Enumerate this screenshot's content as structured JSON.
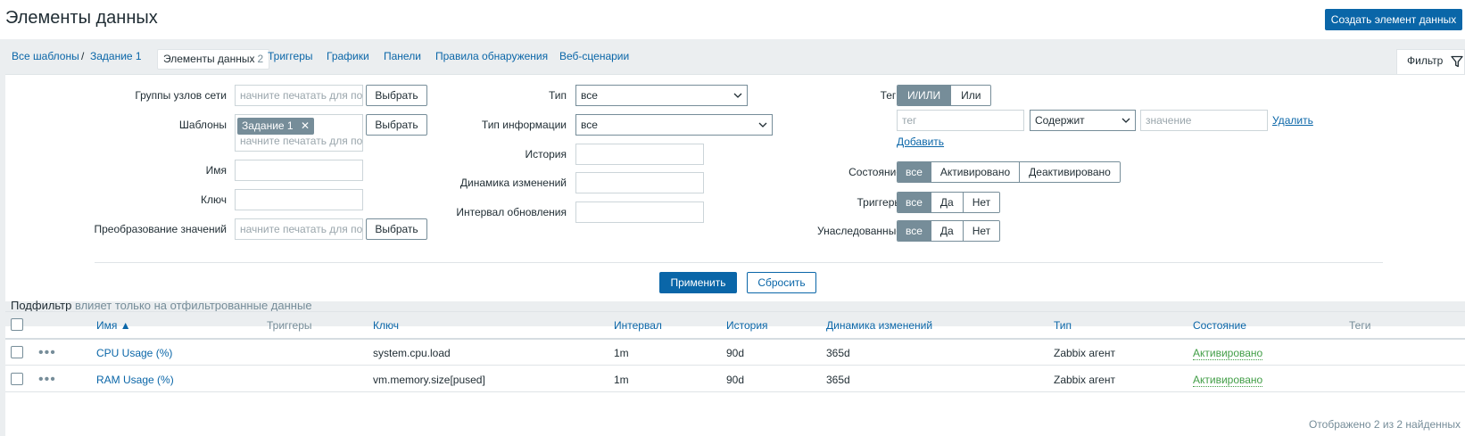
{
  "header": {
    "title": "Элементы данных",
    "create_button": "Создать элемент данных"
  },
  "nav": {
    "all_templates": "Все шаблоны",
    "separator": "/",
    "template": "Задание 1",
    "current": "Элементы данных",
    "current_count": "2",
    "triggers": "Триггеры",
    "graphs": "Графики",
    "dashboards": "Панели",
    "discovery": "Правила обнаружения",
    "web": "Веб-сценарии"
  },
  "filter_tab": {
    "label": "Фильтр",
    "icon": "filter-icon"
  },
  "filter": {
    "host_groups": {
      "label": "Группы узлов сети",
      "placeholder": "начните печатать для по",
      "button": "Выбрать"
    },
    "templates": {
      "label": "Шаблоны",
      "chip": "Задание 1",
      "placeholder": "начните печатать для по",
      "button": "Выбрать"
    },
    "name": {
      "label": "Имя",
      "value": ""
    },
    "key": {
      "label": "Ключ",
      "value": ""
    },
    "valuemap": {
      "label": "Преобразование значений",
      "placeholder": "начните печатать для по",
      "button": "Выбрать"
    },
    "type": {
      "label": "Тип",
      "value": "все"
    },
    "info_type": {
      "label": "Тип информации",
      "value": "все"
    },
    "history": {
      "label": "История",
      "value": ""
    },
    "trends": {
      "label": "Динамика изменений",
      "value": ""
    },
    "interval": {
      "label": "Интервал обновления",
      "value": ""
    },
    "tags": {
      "label": "Теги",
      "opt_andor": "И/ИЛИ",
      "opt_or": "Или",
      "tag_placeholder": "тег",
      "operator": "Содержит",
      "value_placeholder": "значение",
      "remove": "Удалить",
      "add": "Добавить"
    },
    "state": {
      "label": "Состояние",
      "opt_all": "все",
      "opt_enabled": "Активировано",
      "opt_disabled": "Деактивировано"
    },
    "triggers": {
      "label": "Триггеры",
      "opt_all": "все",
      "opt_yes": "Да",
      "opt_no": "Нет"
    },
    "inherited": {
      "label": "Унаследованные",
      "opt_all": "все",
      "opt_yes": "Да",
      "opt_no": "Нет"
    },
    "apply": "Применить",
    "reset": "Сбросить"
  },
  "subfilter": {
    "title": "Подфильтр",
    "note": "влияет только на отфильтрованные данные"
  },
  "table": {
    "columns": {
      "name": "Имя ▲",
      "triggers": "Триггеры",
      "key": "Ключ",
      "interval": "Интервал",
      "history": "История",
      "trends": "Динамика изменений",
      "type": "Тип",
      "status": "Состояние",
      "tags": "Теги"
    },
    "rows": [
      {
        "name": "CPU Usage (%)",
        "key": "system.cpu.load",
        "interval": "1m",
        "history": "90d",
        "trends": "365d",
        "type": "Zabbix агент",
        "status": "Активировано"
      },
      {
        "name": "RAM Usage (%)",
        "key": "vm.memory.size[pused]",
        "interval": "1m",
        "history": "90d",
        "trends": "365d",
        "type": "Zabbix агент",
        "status": "Активировано"
      }
    ],
    "footer": "Отображено 2 из 2 найденных"
  },
  "colors": {
    "accent": "#0a66a8",
    "active_segment": "#768d99",
    "status_green": "#429e47"
  }
}
